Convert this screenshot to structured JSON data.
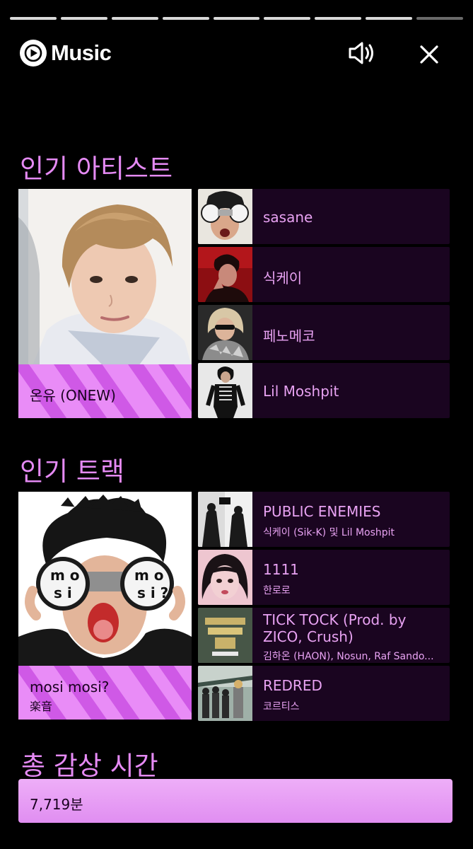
{
  "header": {
    "logo_text": "Music",
    "progress_segments_total": 9,
    "progress_segments_active": 8
  },
  "top_artists": {
    "heading": "인기 아티스트",
    "featured": {
      "name": "온유 (ONEW)"
    },
    "list": [
      {
        "name": "sasane"
      },
      {
        "name": "식케이"
      },
      {
        "name": "페노메코"
      },
      {
        "name": "Lil Moshpit"
      }
    ]
  },
  "top_tracks": {
    "heading": "인기 트랙",
    "featured": {
      "title": "mosi mosi?",
      "artist": "楽音"
    },
    "list": [
      {
        "title": "PUBLIC ENEMIES",
        "artist": "식케이 (Sik-K) 및 Lil Moshpit"
      },
      {
        "title": "1111",
        "artist": "한로로"
      },
      {
        "title": "TICK TOCK (Prod. by ZICO, Crush)",
        "artist": "김하온 (HAON), Nosun, Raf Sando..."
      },
      {
        "title": "REDRED",
        "artist": "코르티스"
      }
    ]
  },
  "total_listening": {
    "heading": "총 감상 시간",
    "value": "7,719분"
  },
  "colors": {
    "accent": "#e58af4",
    "card_bg": "#1a0520",
    "caption_bg": "#e98cf7",
    "background": "#000000"
  }
}
